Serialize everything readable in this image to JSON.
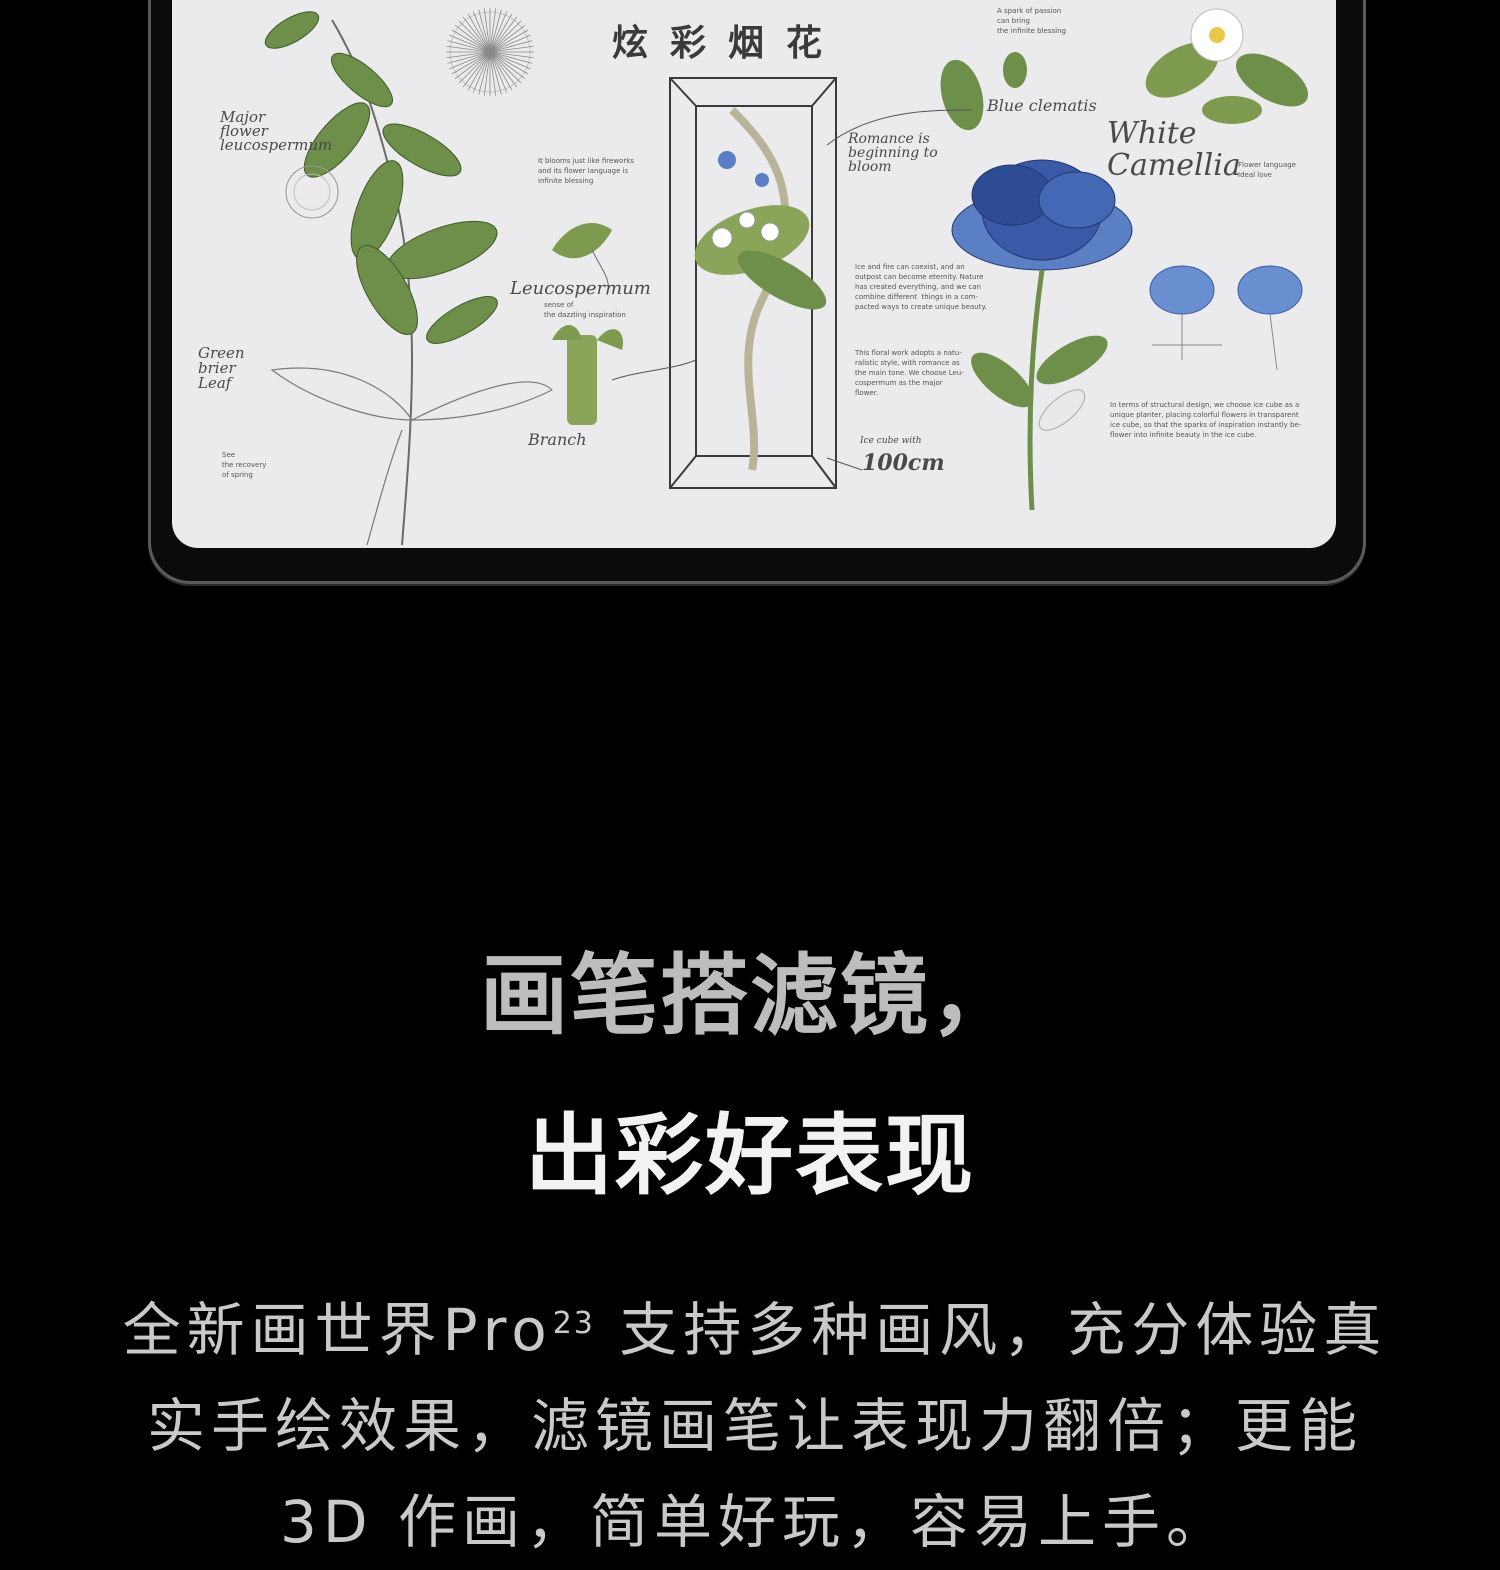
{
  "artwork": {
    "title": "炫彩烟花",
    "notes": {
      "top_right": "A spark of passion\ncan bring\nthe infinite blessing",
      "left_para": "It blooms just like fireworks\nand its flower language is\ninfinite blessing",
      "center_para_1": "Ice and fire can coexist, and an\noutpost can become eternity. Nature\nhas created everything, and we can\ncombine different  things in a com-\npacted ways to create unique beauty.",
      "center_para_2": "This floral work adopts a natu-\nralistic style, with romance as\nthe main tone. We choose Leu-\ncospermum as the major\nflower.",
      "right_para": "In terms of structural design, we choose ice cube as a\nunique planter, placing colorful flowers in transparent\nice cube, so that the sparks of inspiration instantly be-\nflower into infinite beauty in the ice cube.",
      "camellia_note": "Flower language\nIdeal love",
      "spring_note": "See\nthe recovery\nof spring",
      "leucos_note": "sense of\nthe dazzling inspiration"
    },
    "script_labels": {
      "major": "Major\nflower\nleucospermum",
      "leucospermum": "Leucospermum",
      "green": "Green\nbrier\nLeaf",
      "branch": "Branch",
      "romance": "Romance is\nbeginning to\nbloom",
      "blue": "Blue clematis",
      "white": "White\nCamellia",
      "size_label": "Ice cube with",
      "size": "100cm"
    }
  },
  "headline": {
    "line1": "画笔搭滤镜，",
    "line2": "出彩好表现"
  },
  "body": {
    "pre": "全新画世界Pro",
    "sup": "23",
    "post": " 支持多种画风，充分体验真实手绘效果，滤镜画笔让表现力翻倍；更能 3D 作画，简单好玩，容易上手。"
  },
  "colors": {
    "background": "#000000",
    "screen": "#ebebed",
    "leaf_green": "#6e8f4a",
    "flower_blue": "#3a5aa8",
    "headline_grey": "#bdbdbd",
    "headline_white": "#f2f2f2",
    "body_grey": "#c9c9c9"
  }
}
